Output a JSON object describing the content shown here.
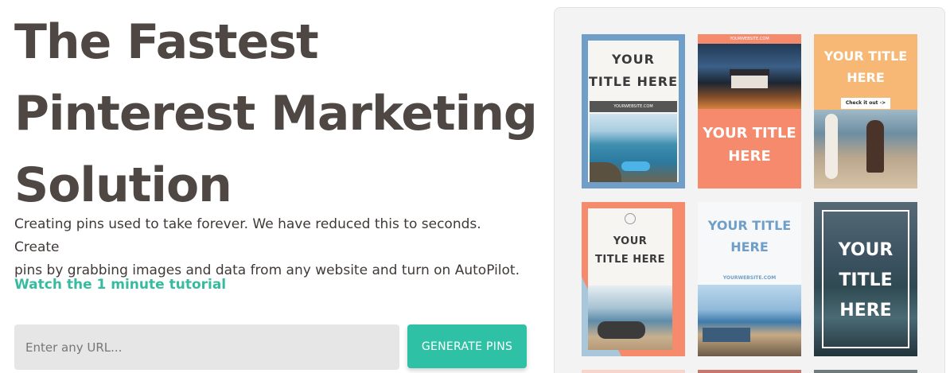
{
  "hero": {
    "title_lines": [
      "The Fastest",
      "Pinterest Marketing",
      "Solution"
    ],
    "description_line1": "Creating pins used to take forever. We have reduced this to seconds. Create",
    "description_line2": "pins by grabbing images and data from any website and turn on AutoPilot.",
    "tutorial_link": "Watch the 1 minute tutorial",
    "url_placeholder": "Enter any URL...",
    "generate_button": "GENERATE PINS"
  },
  "gallery": {
    "pins": [
      {
        "title_line1": "YOUR",
        "title_line2": "TITLE HERE",
        "website": "YOURWEBSITE.COM"
      },
      {
        "header": "YOURWEBSITE.COM",
        "title_line1": "YOUR TITLE",
        "title_line2": "HERE"
      },
      {
        "title_line1": "YOUR TITLE",
        "title_line2": "HERE",
        "cta": "Check it out ->"
      },
      {
        "title_line1": "YOUR",
        "title_line2": "TITLE HERE"
      },
      {
        "title_line1": "YOUR TITLE",
        "title_line2": "HERE",
        "website": "YOURWEBSITE.COM"
      },
      {
        "title_line1": "YOUR",
        "title_line2": "TITLE",
        "title_line3": "HERE"
      }
    ]
  },
  "colors": {
    "accent": "#2fc1a5",
    "link": "#36bba0",
    "title": "#4f4743",
    "coral": "#f58a6c",
    "blue": "#6f9fc8",
    "orange": "#f6b874"
  }
}
